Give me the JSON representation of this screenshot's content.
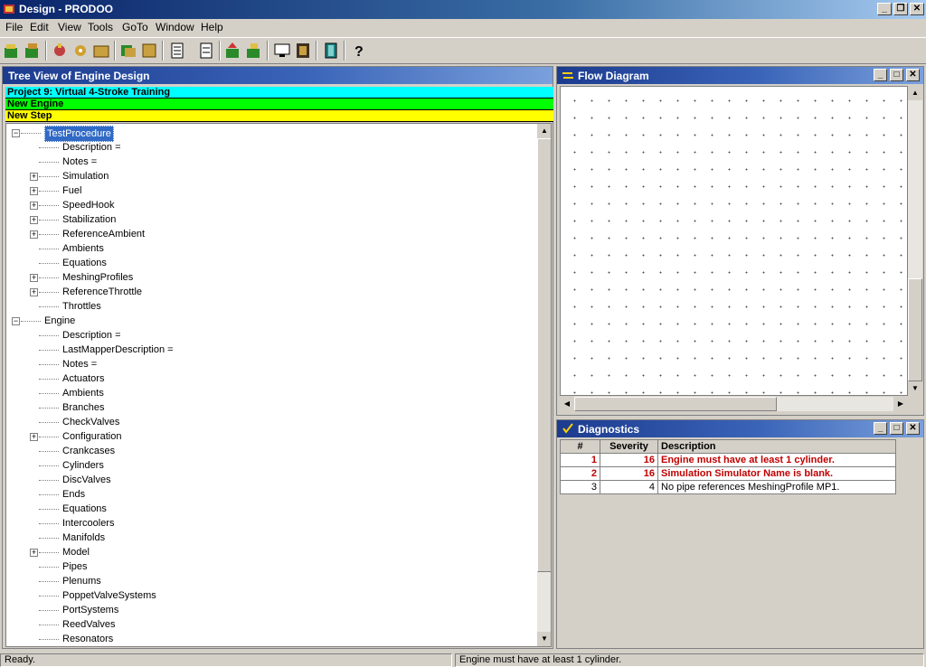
{
  "window": {
    "title": "Design - PRODOO"
  },
  "menu": [
    "File",
    "Edit",
    "View",
    "Tools",
    "GoTo",
    "Window",
    "Help"
  ],
  "tree_panel": {
    "title": "Tree View of Engine Design",
    "bars": [
      {
        "label": "Project 9: Virtual 4-Stroke Training",
        "color": "#00ffff"
      },
      {
        "label": "New Engine",
        "color": "#00ff00"
      },
      {
        "label": "New Step",
        "color": "#ffff00"
      }
    ],
    "items": [
      {
        "label": "TestProcedure",
        "level": 0,
        "expander": "minus",
        "selected": true
      },
      {
        "label": "Description =",
        "level": 1,
        "expander": ""
      },
      {
        "label": "Notes =",
        "level": 1,
        "expander": ""
      },
      {
        "label": "Simulation",
        "level": 1,
        "expander": "plus"
      },
      {
        "label": "Fuel",
        "level": 1,
        "expander": "plus"
      },
      {
        "label": "SpeedHook",
        "level": 1,
        "expander": "plus"
      },
      {
        "label": "Stabilization",
        "level": 1,
        "expander": "plus"
      },
      {
        "label": "ReferenceAmbient",
        "level": 1,
        "expander": "plus"
      },
      {
        "label": "Ambients",
        "level": 1,
        "expander": ""
      },
      {
        "label": "Equations",
        "level": 1,
        "expander": ""
      },
      {
        "label": "MeshingProfiles",
        "level": 1,
        "expander": "plus"
      },
      {
        "label": "ReferenceThrottle",
        "level": 1,
        "expander": "plus"
      },
      {
        "label": "Throttles",
        "level": 1,
        "expander": ""
      },
      {
        "label": "Engine",
        "level": 0,
        "expander": "minus"
      },
      {
        "label": "Description =",
        "level": 1,
        "expander": ""
      },
      {
        "label": "LastMapperDescription =",
        "level": 1,
        "expander": ""
      },
      {
        "label": "Notes =",
        "level": 1,
        "expander": ""
      },
      {
        "label": "Actuators",
        "level": 1,
        "expander": ""
      },
      {
        "label": "Ambients",
        "level": 1,
        "expander": ""
      },
      {
        "label": "Branches",
        "level": 1,
        "expander": ""
      },
      {
        "label": "CheckValves",
        "level": 1,
        "expander": ""
      },
      {
        "label": "Configuration",
        "level": 1,
        "expander": "plus"
      },
      {
        "label": "Crankcases",
        "level": 1,
        "expander": ""
      },
      {
        "label": "Cylinders",
        "level": 1,
        "expander": ""
      },
      {
        "label": "DiscValves",
        "level": 1,
        "expander": ""
      },
      {
        "label": "Ends",
        "level": 1,
        "expander": ""
      },
      {
        "label": "Equations",
        "level": 1,
        "expander": ""
      },
      {
        "label": "Intercoolers",
        "level": 1,
        "expander": ""
      },
      {
        "label": "Manifolds",
        "level": 1,
        "expander": ""
      },
      {
        "label": "Model",
        "level": 1,
        "expander": "plus"
      },
      {
        "label": "Pipes",
        "level": 1,
        "expander": ""
      },
      {
        "label": "Plenums",
        "level": 1,
        "expander": ""
      },
      {
        "label": "PoppetValveSystems",
        "level": 1,
        "expander": ""
      },
      {
        "label": "PortSystems",
        "level": 1,
        "expander": ""
      },
      {
        "label": "ReedValves",
        "level": 1,
        "expander": ""
      },
      {
        "label": "Resonators",
        "level": 1,
        "expander": ""
      }
    ]
  },
  "flow_panel": {
    "title": "Flow Diagram"
  },
  "diagnostics": {
    "title": "Diagnostics",
    "columns": [
      "#",
      "Severity",
      "Description"
    ],
    "rows": [
      {
        "num": "1",
        "severity": "16",
        "description": "Engine must have at least 1 cylinder.",
        "error": true
      },
      {
        "num": "2",
        "severity": "16",
        "description": "Simulation Simulator Name is blank.",
        "error": true
      },
      {
        "num": "3",
        "severity": "4",
        "description": "No pipe references MeshingProfile MP1.",
        "error": false
      }
    ]
  },
  "status": {
    "left": "Ready.",
    "right": "Engine must have at least 1 cylinder."
  }
}
